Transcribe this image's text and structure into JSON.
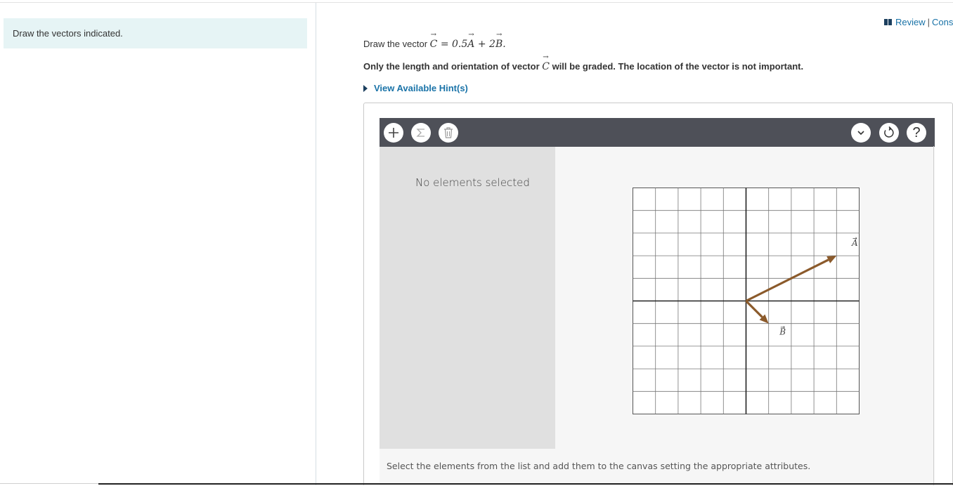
{
  "left_panel": {
    "instruction": "Draw the vectors indicated."
  },
  "header": {
    "review_label": "Review",
    "separator": "|",
    "constants_label": "Cons"
  },
  "question": {
    "prefix": "Draw the vector ",
    "equation": {
      "c": "C",
      "eq": " = 0.5",
      "a": "A",
      "plus": " + 2",
      "b": "B",
      "end": "."
    },
    "note_prefix": "Only the length and orientation of vector ",
    "note_vec": "C",
    "note_suffix": " will be graded. The location of the vector is not important.",
    "hint_label": "View Available Hint(s)"
  },
  "toolbar": {
    "add_icon": "plus-icon",
    "sum_icon": "sigma-icon",
    "delete_icon": "trash-icon",
    "dropdown_icon": "chevron-down-icon",
    "reset_icon": "reset-icon",
    "help_icon": "question-icon",
    "help_label": "?"
  },
  "sidebar": {
    "empty_text": "No elements selected"
  },
  "canvas": {
    "footer_text": "Select the elements from the list and add them to the canvas setting the appropriate attributes.",
    "grid": {
      "columns": 10,
      "rows": 10,
      "x_range": [
        -5,
        5
      ],
      "y_range": [
        -5,
        5
      ],
      "axes_at_origin": true
    },
    "vectors": [
      {
        "label": "A",
        "tail": [
          0,
          0
        ],
        "head": [
          4,
          2
        ],
        "color": "#8b5a2b"
      },
      {
        "label": "B",
        "tail": [
          0,
          0
        ],
        "head": [
          1,
          -1
        ],
        "color": "#8b5a2b"
      }
    ]
  }
}
